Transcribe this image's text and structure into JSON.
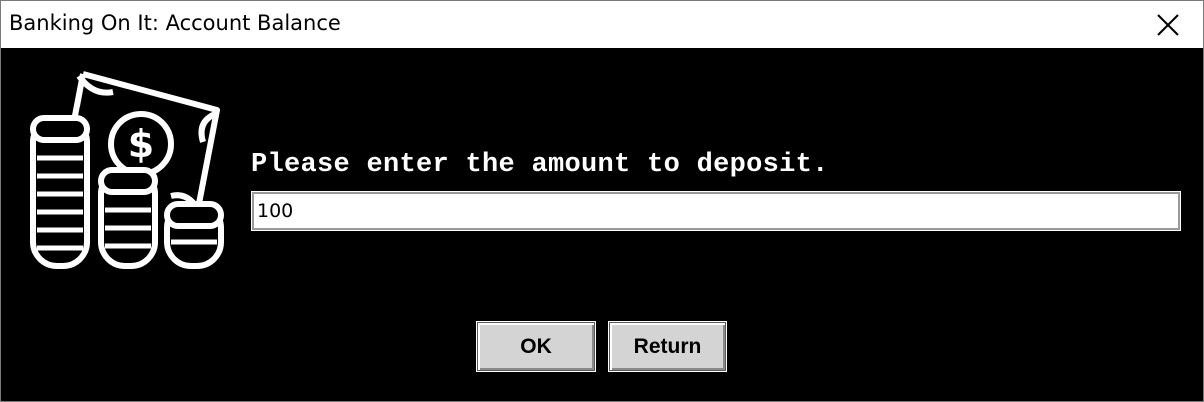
{
  "window": {
    "title": "Banking On It: Account Balance"
  },
  "dialog": {
    "icon": "money-coins-icon",
    "prompt": "Please enter the amount to deposit.",
    "amount_value": "100",
    "buttons": {
      "ok_label": "OK",
      "return_label": "Return"
    }
  },
  "colors": {
    "background": "#000000",
    "text": "#ffffff",
    "button_face": "#d4d4d4"
  }
}
